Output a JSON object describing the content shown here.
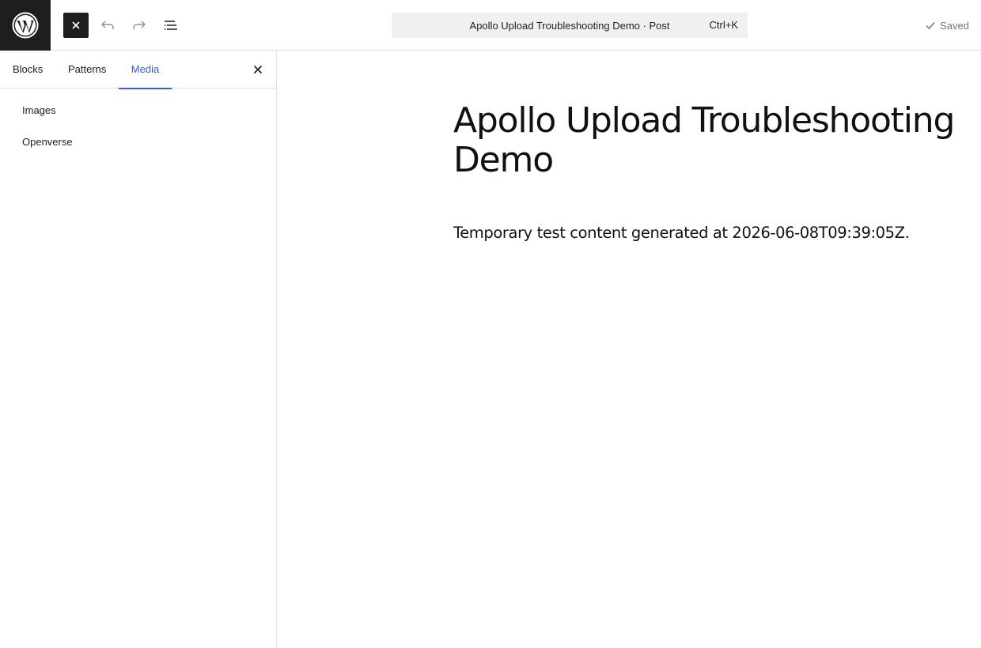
{
  "topbar": {
    "logo_icon": "wordpress-logo",
    "close_icon": "close-icon",
    "undo_icon": "undo-icon",
    "redo_icon": "redo-icon",
    "list_view_icon": "list-view-icon",
    "command_title": "Apollo Upload Troubleshooting Demo · Post",
    "command_shortcut": "Ctrl+K",
    "saved_label": "Saved"
  },
  "sidebar": {
    "tabs": [
      {
        "label": "Blocks"
      },
      {
        "label": "Patterns"
      },
      {
        "label": "Media",
        "active": true
      }
    ],
    "media_items": [
      {
        "label": "Images"
      },
      {
        "label": "Openverse"
      }
    ]
  },
  "post": {
    "title": "Apollo Upload Troubleshooting Demo",
    "paragraph": "Temporary test content generated at 2026-06-08T09:39:05Z."
  },
  "colors": {
    "accent": "#3858e9",
    "dark": "#1e1e1e",
    "muted": "#757575"
  }
}
